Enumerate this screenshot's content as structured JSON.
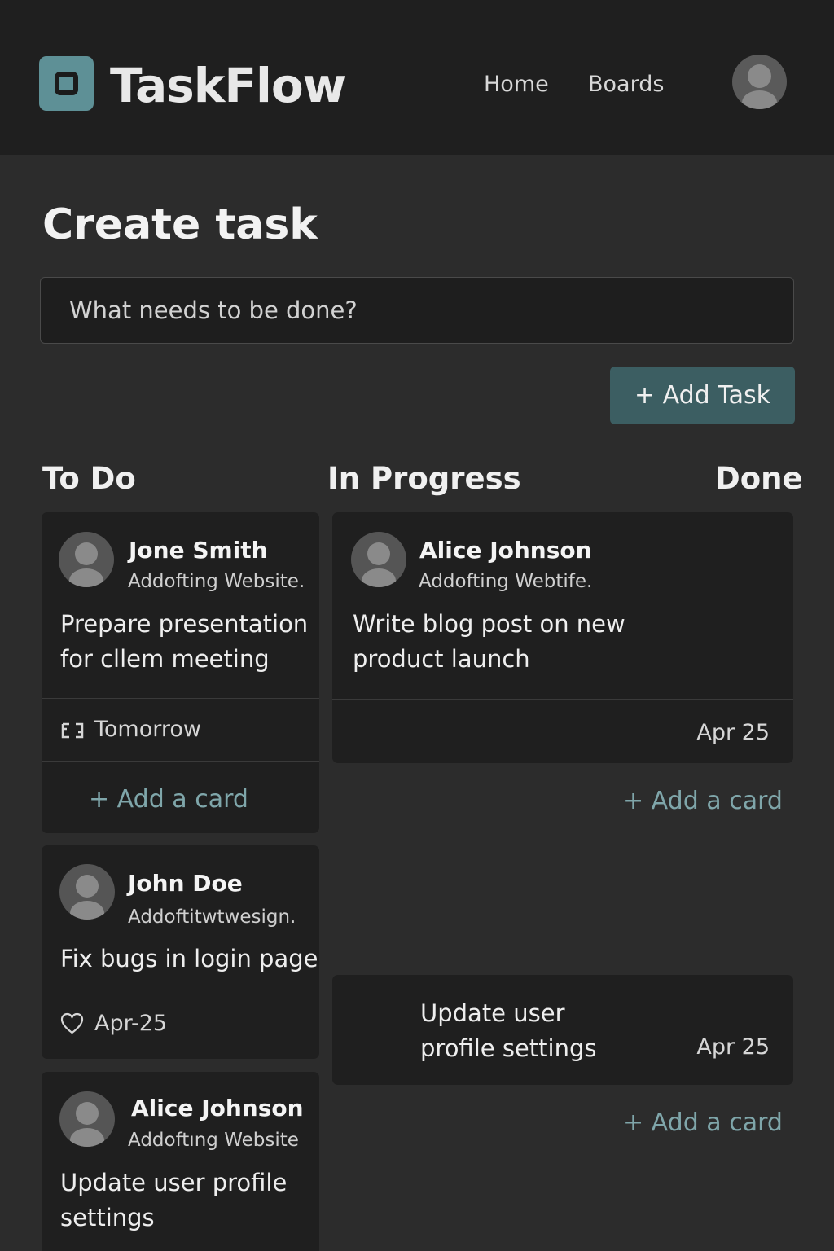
{
  "app": {
    "name": "TaskFlow",
    "accent_color": "#5e9096",
    "button_color": "#3c5e62"
  },
  "nav": {
    "items": [
      {
        "label": "Home"
      },
      {
        "label": "Boards"
      }
    ],
    "profile_icon": "user-avatar-icon"
  },
  "create": {
    "title": "Create task",
    "input_placeholder": "What needs to be done?",
    "add_button_label": "+ Add Task"
  },
  "board": {
    "add_card_label": "+ Add a card",
    "columns": [
      {
        "name": "To Do",
        "cards": [
          {
            "assignee": "Jone Smith",
            "project": "Addofting Website.",
            "title_lines": [
              "Prepare presentation",
              "for cllem meeting"
            ],
            "due": "Tomorrow",
            "due_icon": "calendar-icon"
          },
          {
            "assignee": "John Doe",
            "project": "Addoftitwtwesign.",
            "title_lines": [
              "Fix bugs in login page"
            ],
            "due": "Apr-25",
            "due_icon": "heart-icon"
          },
          {
            "assignee": "Alice Johnson",
            "project": "Addoftıng Website",
            "title_lines": [
              "Update user profile",
              "settings"
            ]
          }
        ]
      },
      {
        "name": "In Progress",
        "cards": [
          {
            "assignee": "Alice Johnson",
            "project": "Addofting Webtife.",
            "title_lines": [
              "Write blog post on new",
              "product launch"
            ],
            "due": "Apr 25"
          },
          {
            "title_lines": [
              "Update user",
              "profile settings"
            ],
            "due": "Apr 25"
          }
        ]
      },
      {
        "name": "Done",
        "cards": []
      }
    ]
  }
}
